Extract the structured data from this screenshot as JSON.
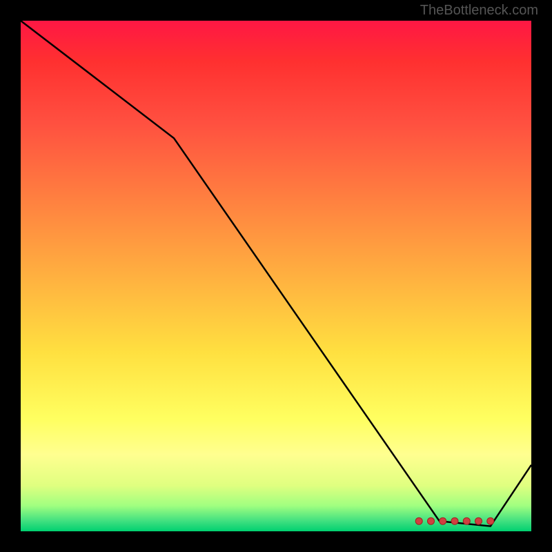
{
  "watermark": "TheBottleneck.com",
  "chart_data": {
    "type": "line",
    "title": "",
    "xlabel": "",
    "ylabel": "",
    "xlim": [
      0,
      100
    ],
    "ylim": [
      0,
      100
    ],
    "x": [
      0,
      30,
      82,
      92,
      100
    ],
    "y": [
      100,
      77,
      2,
      1,
      13
    ],
    "marker_region": {
      "x_start": 78,
      "x_end": 92,
      "y": 2
    },
    "background_gradient": [
      "#ff1744",
      "#ffb040",
      "#ffff60",
      "#00d070"
    ]
  }
}
